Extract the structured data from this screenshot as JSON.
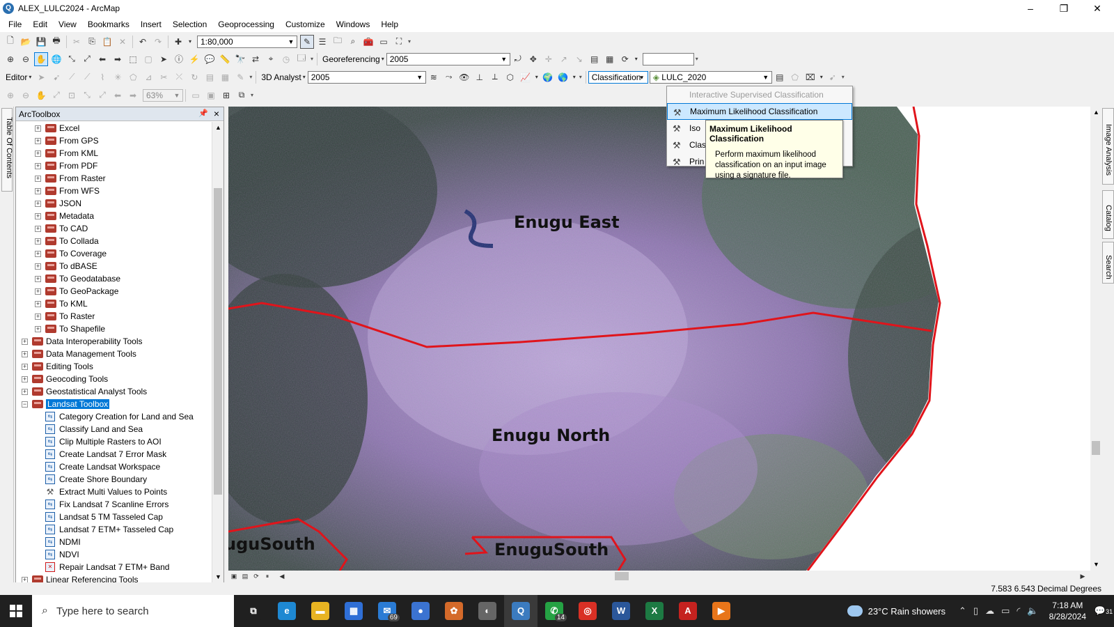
{
  "window": {
    "title": "ALEX_LULC2024 - ArcMap",
    "controls": [
      "–",
      "❐",
      "✕"
    ]
  },
  "menubar": [
    "File",
    "Edit",
    "View",
    "Bookmarks",
    "Insert",
    "Selection",
    "Geoprocessing",
    "Customize",
    "Windows",
    "Help"
  ],
  "toolbar1": {
    "scale": "1:80,000"
  },
  "toolbar2": {
    "georef_label": "Georeferencing",
    "georef_layer": "2005",
    "georef_field": ""
  },
  "toolbar3": {
    "editor_label": "Editor",
    "analyst_label": "3D Analyst",
    "analyst_layer": "2005",
    "classification_label": "Classification",
    "classification_layer": "LULC_2020"
  },
  "toolbar4": {
    "zoom": "63%"
  },
  "left_strip": {
    "tab_label": "Table Of Contents"
  },
  "toolbox": {
    "title": "ArcToolbox",
    "items": [
      {
        "label": "Excel",
        "level": 1,
        "kind": "toolset",
        "exp": "+"
      },
      {
        "label": "From GPS",
        "level": 1,
        "kind": "toolset",
        "exp": "+"
      },
      {
        "label": "From KML",
        "level": 1,
        "kind": "toolset",
        "exp": "+"
      },
      {
        "label": "From PDF",
        "level": 1,
        "kind": "toolset",
        "exp": "+"
      },
      {
        "label": "From Raster",
        "level": 1,
        "kind": "toolset",
        "exp": "+"
      },
      {
        "label": "From WFS",
        "level": 1,
        "kind": "toolset",
        "exp": "+"
      },
      {
        "label": "JSON",
        "level": 1,
        "kind": "toolset",
        "exp": "+"
      },
      {
        "label": "Metadata",
        "level": 1,
        "kind": "toolset",
        "exp": "+"
      },
      {
        "label": "To CAD",
        "level": 1,
        "kind": "toolset",
        "exp": "+"
      },
      {
        "label": "To Collada",
        "level": 1,
        "kind": "toolset",
        "exp": "+"
      },
      {
        "label": "To Coverage",
        "level": 1,
        "kind": "toolset",
        "exp": "+"
      },
      {
        "label": "To dBASE",
        "level": 1,
        "kind": "toolset",
        "exp": "+"
      },
      {
        "label": "To Geodatabase",
        "level": 1,
        "kind": "toolset",
        "exp": "+"
      },
      {
        "label": "To GeoPackage",
        "level": 1,
        "kind": "toolset",
        "exp": "+"
      },
      {
        "label": "To KML",
        "level": 1,
        "kind": "toolset",
        "exp": "+"
      },
      {
        "label": "To Raster",
        "level": 1,
        "kind": "toolset",
        "exp": "+"
      },
      {
        "label": "To Shapefile",
        "level": 1,
        "kind": "toolset",
        "exp": "+"
      },
      {
        "label": "Data Interoperability Tools",
        "level": 0,
        "kind": "toolbox",
        "exp": "+"
      },
      {
        "label": "Data Management Tools",
        "level": 0,
        "kind": "toolbox",
        "exp": "+"
      },
      {
        "label": "Editing Tools",
        "level": 0,
        "kind": "toolbox",
        "exp": "+"
      },
      {
        "label": "Geocoding Tools",
        "level": 0,
        "kind": "toolbox",
        "exp": "+"
      },
      {
        "label": "Geostatistical Analyst Tools",
        "level": 0,
        "kind": "toolbox",
        "exp": "+"
      },
      {
        "label": "Landsat Toolbox",
        "level": 0,
        "kind": "toolbox",
        "exp": "−",
        "selected": true
      },
      {
        "label": "Category Creation for Land and Sea",
        "level": 1,
        "kind": "script"
      },
      {
        "label": "Classify Land and Sea",
        "level": 1,
        "kind": "script"
      },
      {
        "label": "Clip Multiple Rasters to AOI",
        "level": 1,
        "kind": "script"
      },
      {
        "label": "Create Landsat 7 Error Mask",
        "level": 1,
        "kind": "script"
      },
      {
        "label": "Create Landsat Workspace",
        "level": 1,
        "kind": "script"
      },
      {
        "label": "Create Shore Boundary",
        "level": 1,
        "kind": "script"
      },
      {
        "label": "Extract Multi Values to Points",
        "level": 1,
        "kind": "tool"
      },
      {
        "label": "Fix Landsat 7 Scanline Errors",
        "level": 1,
        "kind": "script"
      },
      {
        "label": "Landsat 5 TM Tasseled Cap",
        "level": 1,
        "kind": "script"
      },
      {
        "label": "Landsat 7 ETM+ Tasseled Cap",
        "level": 1,
        "kind": "script"
      },
      {
        "label": "NDMI",
        "level": 1,
        "kind": "script"
      },
      {
        "label": "NDVI",
        "level": 1,
        "kind": "script"
      },
      {
        "label": "Repair Landsat 7 ETM+ Band",
        "level": 1,
        "kind": "script-error"
      },
      {
        "label": "Linear Referencing Tools",
        "level": 0,
        "kind": "toolbox",
        "exp": "+"
      }
    ]
  },
  "map": {
    "labels": [
      {
        "text": "Enugu East"
      },
      {
        "text": "Enugu North"
      },
      {
        "text": "EnuguSouth"
      },
      {
        "text": "uguSouth"
      }
    ],
    "boundary_color": "#e0141b"
  },
  "right_strip": {
    "tabs": [
      "Image Analysis",
      "Catalog",
      "Search"
    ]
  },
  "status": {
    "coords": "7.583  6.543 Decimal Degrees"
  },
  "classification_menu": {
    "items": [
      {
        "label": "Interactive Supervised Classification",
        "state": "disabled"
      },
      {
        "label": "Maximum Likelihood Classification",
        "state": "hover"
      },
      {
        "label": "Iso",
        "state": "normal"
      },
      {
        "label": "Clas",
        "state": "normal"
      },
      {
        "label": "Prin",
        "state": "normal"
      }
    ],
    "tooltip": {
      "title": "Maximum Likelihood Classification",
      "body": "Perform maximum likelihood classification on an input image using a signature file."
    }
  },
  "taskbar": {
    "search_placeholder": "Type here to search",
    "apps": [
      {
        "name": "task-view",
        "glyph": "⧉",
        "color": "#202020"
      },
      {
        "name": "edge",
        "glyph": "e",
        "color": "#1e88d2"
      },
      {
        "name": "file-explorer",
        "glyph": "▬",
        "color": "#e8b422"
      },
      {
        "name": "microsoft-store",
        "glyph": "▦",
        "color": "#2f6fd6"
      },
      {
        "name": "mail",
        "glyph": "✉",
        "color": "#2a7bd4",
        "badge": "69"
      },
      {
        "name": "app-blue-orb",
        "glyph": "●",
        "color": "#3b73d1"
      },
      {
        "name": "photos",
        "glyph": "✿",
        "color": "#d46a2a"
      },
      {
        "name": "arcgis-pro",
        "glyph": "◐",
        "color": "#666666"
      },
      {
        "name": "arcmap",
        "glyph": "Q",
        "color": "#3b7bbf",
        "active": true
      },
      {
        "name": "whatsapp",
        "glyph": "✆",
        "color": "#25a244",
        "badge": "14"
      },
      {
        "name": "chrome",
        "glyph": "◎",
        "color": "#d93025"
      },
      {
        "name": "word",
        "glyph": "W",
        "color": "#2b579a"
      },
      {
        "name": "excel",
        "glyph": "X",
        "color": "#1d7a43"
      },
      {
        "name": "acrobat",
        "glyph": "A",
        "color": "#c5221f"
      },
      {
        "name": "media-player",
        "glyph": "▶",
        "color": "#e8751a"
      }
    ],
    "weather": "23°C  Rain showers",
    "time": "7:18 AM",
    "date": "8/28/2024",
    "notification_count": "31"
  }
}
